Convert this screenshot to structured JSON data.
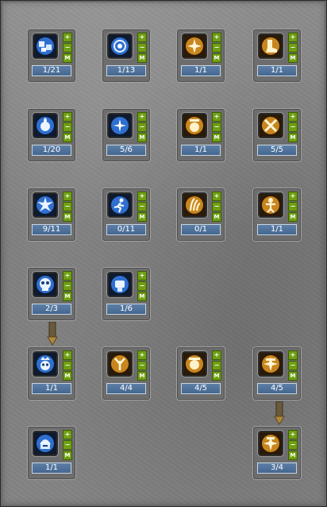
{
  "skills": [
    {
      "id": "skill-r1c1",
      "level": "1/21",
      "icon": "blue-cubes-icon"
    },
    {
      "id": "skill-r1c2",
      "level": "1/13",
      "icon": "blue-target-shield-icon"
    },
    {
      "id": "skill-r1c3",
      "level": "1/1",
      "icon": "gold-burst-icon"
    },
    {
      "id": "skill-r1c4",
      "level": "1/1",
      "icon": "gold-boot-icon"
    },
    {
      "id": "skill-r2c1",
      "level": "1/20",
      "icon": "blue-orb-icon"
    },
    {
      "id": "skill-r2c2",
      "level": "5/6",
      "icon": "blue-sparkle-icon"
    },
    {
      "id": "skill-r2c3",
      "level": "1/1",
      "icon": "gold-atk-icon"
    },
    {
      "id": "skill-r2c4",
      "level": "5/5",
      "icon": "gold-cross-icon"
    },
    {
      "id": "skill-r3c1",
      "level": "9/11",
      "icon": "blue-burst-icon"
    },
    {
      "id": "skill-r3c2",
      "level": "0/11",
      "icon": "blue-runner-icon"
    },
    {
      "id": "skill-r3c3",
      "level": "0/1",
      "icon": "gold-claw-icon"
    },
    {
      "id": "skill-r3c4",
      "level": "1/1",
      "icon": "gold-figure-icon"
    },
    {
      "id": "skill-r4c1",
      "level": "2/3",
      "icon": "blue-skull-icon"
    },
    {
      "id": "skill-r4c2",
      "level": "1/6",
      "icon": "blue-fist-icon"
    },
    {
      "id": "skill-r5c1",
      "level": "1/1",
      "icon": "blue-skull-crown-icon"
    },
    {
      "id": "skill-r5c2",
      "level": "4/4",
      "icon": "gold-figure-icon"
    },
    {
      "id": "skill-r5c3",
      "level": "4/5",
      "icon": "gold-atk-icon"
    },
    {
      "id": "skill-r5c4",
      "level": "4/5",
      "icon": "gold-hp-burst-icon"
    },
    {
      "id": "skill-r6c1",
      "level": "1/1",
      "icon": "blue-helm-icon"
    },
    {
      "id": "skill-r6c4",
      "level": "3/4",
      "icon": "gold-mp-icon"
    }
  ],
  "buttons": {
    "plus": "+",
    "minus": "−",
    "master": "M"
  },
  "colors": {
    "button_green": "#6f9f12",
    "level_blue": "#4f74a0",
    "arrow_gold": "#b08a3c"
  }
}
